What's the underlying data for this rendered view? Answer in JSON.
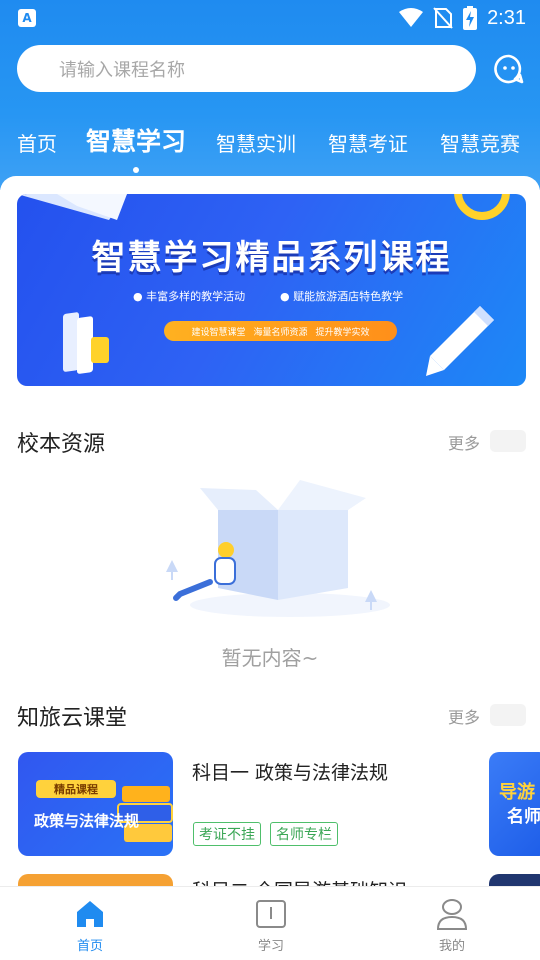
{
  "status_bar": {
    "time": "2:31",
    "app_icon_letter": "A"
  },
  "search": {
    "placeholder": "请输入课程名称"
  },
  "tabs": [
    {
      "label": "首页",
      "active": false
    },
    {
      "label": "智慧学习",
      "active": true
    },
    {
      "label": "智慧实训",
      "active": false
    },
    {
      "label": "智慧考证",
      "active": false
    },
    {
      "label": "智慧竞赛",
      "active": false
    }
  ],
  "banner": {
    "title": "智慧学习精品系列课程",
    "bullet_1": "● 丰富多样的教学活动",
    "bullet_2": "● 赋能旅游酒店特色教学",
    "pill_1": "建设智慧课堂",
    "pill_2": "海量名师资源",
    "pill_3": "提升教学实效"
  },
  "section_school": {
    "title": "校本资源",
    "more": "更多",
    "empty_text": "暂无内容~"
  },
  "section_cloud": {
    "title": "知旅云课堂",
    "more": "更多",
    "courses": [
      {
        "title": "科目一 政策与法律法规",
        "thumb_badge": "精品课程",
        "thumb_title": "政策与法律法规",
        "tags": [
          "考证不挂",
          "名师专栏"
        ]
      },
      {
        "title": "科目二 全国导游基础知识"
      }
    ],
    "peek_thumb": {
      "line1": "导游",
      "line2": "名师"
    }
  },
  "bottom_nav": [
    {
      "label": "首页",
      "icon": "home-icon",
      "active": true
    },
    {
      "label": "学习",
      "icon": "book-icon",
      "active": false
    },
    {
      "label": "我的",
      "icon": "user-icon",
      "active": false
    }
  ],
  "colors": {
    "primary": "#1f8bf0",
    "tag_green": "#3aa655",
    "banner_orange": "#ffa21c"
  }
}
